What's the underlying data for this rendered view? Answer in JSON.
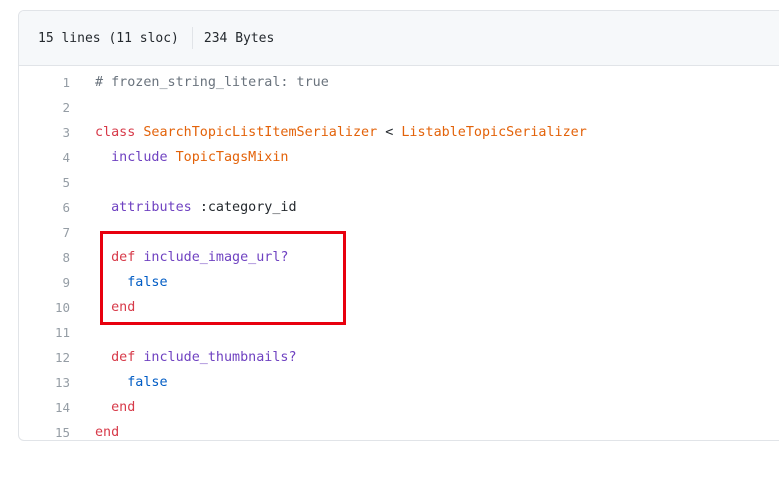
{
  "file_info": {
    "lines_label": "15 lines (11 sloc)",
    "size_label": "234 Bytes"
  },
  "code": {
    "lines": [
      {
        "num": "1",
        "tokens": [
          {
            "t": "# frozen_string_literal: true",
            "k": "comment"
          }
        ]
      },
      {
        "num": "2",
        "tokens": []
      },
      {
        "num": "3",
        "tokens": [
          {
            "t": "class ",
            "k": "kw"
          },
          {
            "t": "SearchTopicListItemSerializer",
            "k": "const"
          },
          {
            "t": " < ",
            "k": "plain"
          },
          {
            "t": "ListableTopicSerializer",
            "k": "const"
          }
        ]
      },
      {
        "num": "4",
        "tokens": [
          {
            "t": "  include ",
            "k": "call"
          },
          {
            "t": "TopicTagsMixin",
            "k": "const"
          }
        ]
      },
      {
        "num": "5",
        "tokens": []
      },
      {
        "num": "6",
        "tokens": [
          {
            "t": "  attributes ",
            "k": "call"
          },
          {
            "t": ":category_id",
            "k": "plain"
          }
        ]
      },
      {
        "num": "7",
        "tokens": []
      },
      {
        "num": "8",
        "tokens": [
          {
            "t": "  def ",
            "k": "kw"
          },
          {
            "t": "include_image_url?",
            "k": "ent"
          }
        ]
      },
      {
        "num": "9",
        "tokens": [
          {
            "t": "    false",
            "k": "sym"
          }
        ]
      },
      {
        "num": "10",
        "tokens": [
          {
            "t": "  end",
            "k": "kw"
          }
        ]
      },
      {
        "num": "11",
        "tokens": []
      },
      {
        "num": "12",
        "tokens": [
          {
            "t": "  def ",
            "k": "kw"
          },
          {
            "t": "include_thumbnails?",
            "k": "ent"
          }
        ]
      },
      {
        "num": "13",
        "tokens": [
          {
            "t": "    false",
            "k": "sym"
          }
        ]
      },
      {
        "num": "14",
        "tokens": [
          {
            "t": "  end",
            "k": "kw"
          }
        ]
      },
      {
        "num": "15",
        "tokens": [
          {
            "t": "end",
            "k": "kw"
          }
        ]
      }
    ]
  },
  "annotation": {
    "highlight_color": "#e8000e",
    "highlighted_lines": [
      "8",
      "9",
      "10"
    ]
  }
}
